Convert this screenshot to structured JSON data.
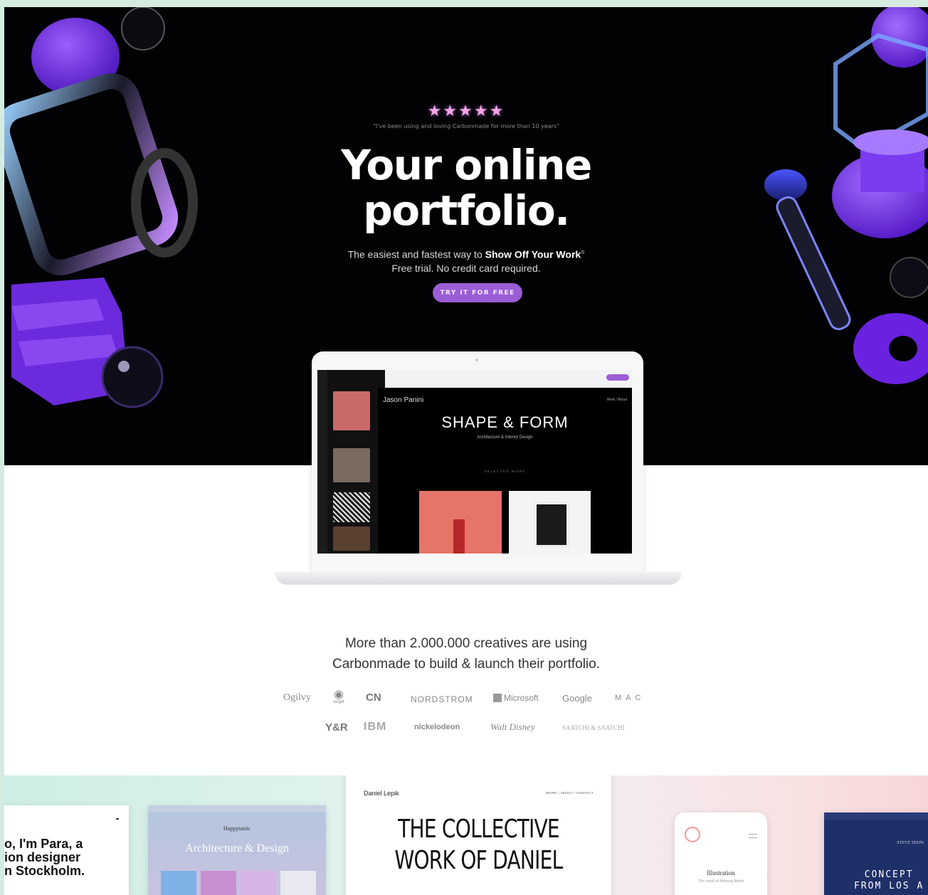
{
  "hero": {
    "stars": "★★★★★",
    "quote": "\"I've been using and loving Carbonmade for more than 10 years\"",
    "headline_line1": "Your online",
    "headline_line2": "portfolio.",
    "sub_prefix": "The easiest and fastest way to ",
    "sub_bold": "Show Off Your Work",
    "sub_mark": "®",
    "sub_line2": "Free trial. No credit card required.",
    "cta": "TRY IT FOR FREE"
  },
  "laptop": {
    "name": "Jason Panini",
    "nav": "Work / About",
    "title": "SHAPE & FORM",
    "subtitle": "Architecture & Interior Design",
    "selected": "SELECTED WORK"
  },
  "creatives": {
    "line1": "More than 2.000.000 creatives are using",
    "line2": "Carbonmade to build & launch their portfolio."
  },
  "brands": {
    "ogilvy": "Ogilvy",
    "target": "target",
    "cn": "CN",
    "nordstrom": "NORDSTROM",
    "microsoft": "Microsoft",
    "google": "Google",
    "mac": "MAC",
    "yr": "Y&R",
    "ibm": "IBM",
    "nickelodeon": "nickelodeon",
    "disney": "Walt Disney",
    "saatchi": "SAATCHI & SAATCHI"
  },
  "showcase": {
    "card1_line1": "o, I'm Para, a",
    "card1_line2": "ion designer",
    "card1_line3": "n Stockholm.",
    "card2_brand": "Happytastic",
    "card2_title": "Architecture & Design",
    "card3_name": "Daniel Lepik",
    "card3_nav": "WORK / ABOUT / CONTACT",
    "card3_line1": "THE COLLECTIVE",
    "card3_line2": "WORK OF DANIEL",
    "card4_title": "Illustration",
    "card4_sub": "The work of Adriana Bellet",
    "card5_small": "STEVE TEEPS",
    "card5_line1": "CONCEPT",
    "card5_line2": "FROM LOS A"
  },
  "colors": {
    "accent": "#9b5dd6",
    "hero_bg": "#020204",
    "frame_bg": "#d6ebe0"
  }
}
